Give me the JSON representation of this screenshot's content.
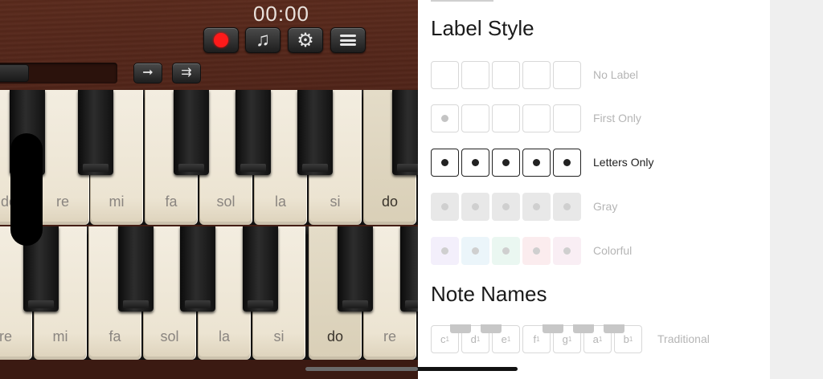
{
  "piano": {
    "timer": "00:00",
    "colors": {
      "record": "#ff1a1a",
      "wood": "#4a2016"
    },
    "buttons": [
      {
        "id": "record",
        "icon": "record-dot-icon"
      },
      {
        "id": "music",
        "icon": "music-note-icon",
        "glyph": "♫"
      },
      {
        "id": "metronome",
        "icon": "gear-icon",
        "glyph": "⚙"
      },
      {
        "id": "menu",
        "icon": "hamburger-menu-icon"
      }
    ],
    "arrows": {
      "single": "➞",
      "double": "⇉"
    },
    "top_keys": [
      "do",
      "re",
      "mi",
      "fa",
      "sol",
      "la",
      "si",
      "do"
    ],
    "bottom_keys": [
      "re",
      "mi",
      "fa",
      "sol",
      "la",
      "si",
      "do",
      "re"
    ]
  },
  "settings": {
    "label_style_title": "Label Style",
    "label_rows": [
      {
        "label": "No Label"
      },
      {
        "label": "First Only"
      },
      {
        "label": "Letters Only",
        "selected": true
      },
      {
        "label": "Gray"
      },
      {
        "label": "Colorful",
        "cell_colors": [
          "#f3effb",
          "#ebf5fa",
          "#eaf7f1",
          "#fbecee",
          "#f9eef4"
        ]
      }
    ],
    "note_names_title": "Note Names",
    "note_cells": [
      "c",
      "d",
      "e",
      "f",
      "g",
      "a",
      "b"
    ],
    "note_superscript": "1",
    "note_row_label": "Traditional"
  }
}
